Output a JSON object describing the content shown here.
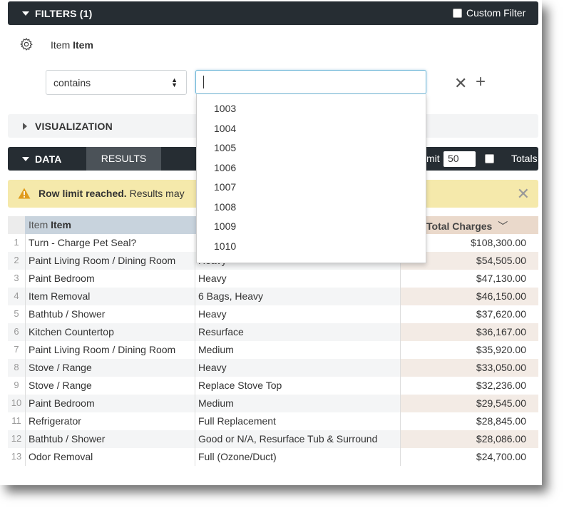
{
  "filters": {
    "title": "FILTERS (1)",
    "custom_filter_label": "Custom Filter",
    "field_label_view": "Item",
    "field_label_field": "Item",
    "operator": "contains",
    "input_value": "",
    "suggestions": [
      "1003",
      "1004",
      "1005",
      "1006",
      "1007",
      "1008",
      "1009",
      "1010"
    ]
  },
  "visualization": {
    "title": "VISUALIZATION"
  },
  "data_bar": {
    "title": "DATA",
    "results_tab": "RESULTS",
    "row_limit_label": "mit",
    "row_limit_value": "50",
    "totals_label": "Totals"
  },
  "warning": {
    "bold_text": "Row limit reached.",
    "text": "Results may"
  },
  "table": {
    "header_item_view": "Item",
    "header_item_field": "Item",
    "header_charges": "Total Charges",
    "rows": [
      {
        "num": "1",
        "item": "Turn - Charge Pet Seal?",
        "sub": "",
        "charges": "$108,300.00"
      },
      {
        "num": "2",
        "item": "Paint Living Room / Dining Room",
        "sub": "Heavy",
        "charges": "$54,505.00"
      },
      {
        "num": "3",
        "item": "Paint Bedroom",
        "sub": "Heavy",
        "charges": "$47,130.00"
      },
      {
        "num": "4",
        "item": "Item Removal",
        "sub": "6 Bags, Heavy",
        "charges": "$46,150.00"
      },
      {
        "num": "5",
        "item": "Bathtub / Shower",
        "sub": "Heavy",
        "charges": "$37,620.00"
      },
      {
        "num": "6",
        "item": "Kitchen Countertop",
        "sub": "Resurface",
        "charges": "$36,167.00"
      },
      {
        "num": "7",
        "item": "Paint Living Room / Dining Room",
        "sub": "Medium",
        "charges": "$35,920.00"
      },
      {
        "num": "8",
        "item": "Stove / Range",
        "sub": "Heavy",
        "charges": "$33,050.00"
      },
      {
        "num": "9",
        "item": "Stove / Range",
        "sub": "Replace Stove Top",
        "charges": "$32,236.00"
      },
      {
        "num": "10",
        "item": "Paint Bedroom",
        "sub": "Medium",
        "charges": "$29,545.00"
      },
      {
        "num": "11",
        "item": "Refrigerator",
        "sub": "Full Replacement",
        "charges": "$28,845.00"
      },
      {
        "num": "12",
        "item": "Bathtub / Shower",
        "sub": "Good or N/A, Resurface Tub & Surround",
        "charges": "$28,086.00"
      },
      {
        "num": "13",
        "item": "Odor Removal",
        "sub": "Full (Ozone/Duct)",
        "charges": "$24,700.00"
      }
    ]
  },
  "colors": {
    "header_bar": "#262d33",
    "warning_bg": "#f5e9ab",
    "dimension_header": "#c8d3dd",
    "measure_header": "#ead9cb"
  }
}
